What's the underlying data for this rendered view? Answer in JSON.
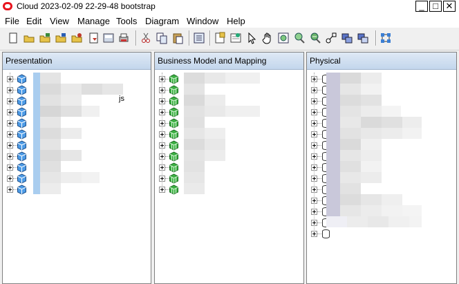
{
  "window": {
    "title": "Cloud 2023-02-09 22-29-48 bootstrap",
    "minimize": "_",
    "maximize": "□",
    "close": "✕"
  },
  "menu": [
    "File",
    "Edit",
    "View",
    "Manage",
    "Tools",
    "Diagram",
    "Window",
    "Help"
  ],
  "toolbar": [
    "new-icon",
    "open-icon",
    "open-offline-icon",
    "open-online-icon",
    "save-icon",
    "import-icon",
    "check-consistency-icon",
    "print-icon",
    "cut-icon",
    "copy-icon",
    "paste-icon",
    "query-log-icon",
    "properties-icon",
    "show-consistency-icon",
    "select-icon",
    "pan-icon",
    "zoom-fit-icon",
    "zoom-in-icon",
    "zoom-out-icon",
    "join-icon",
    "complex-join-icon",
    "hierarchy-icon",
    "layout-icon"
  ],
  "panes": {
    "presentation": {
      "title": "Presentation",
      "rows": 11,
      "partial_label": "js"
    },
    "business": {
      "title": "Business Model and Mapping",
      "rows": 11
    },
    "physical": {
      "title": "Physical",
      "rows": 15
    }
  },
  "colors": {
    "title_icon": "#e8141e",
    "pane_header": "#c3d6ec",
    "presentation_icon": "#4d9be6",
    "business_icon": "#3cb043",
    "physical_icon": "#6a6fb0"
  }
}
